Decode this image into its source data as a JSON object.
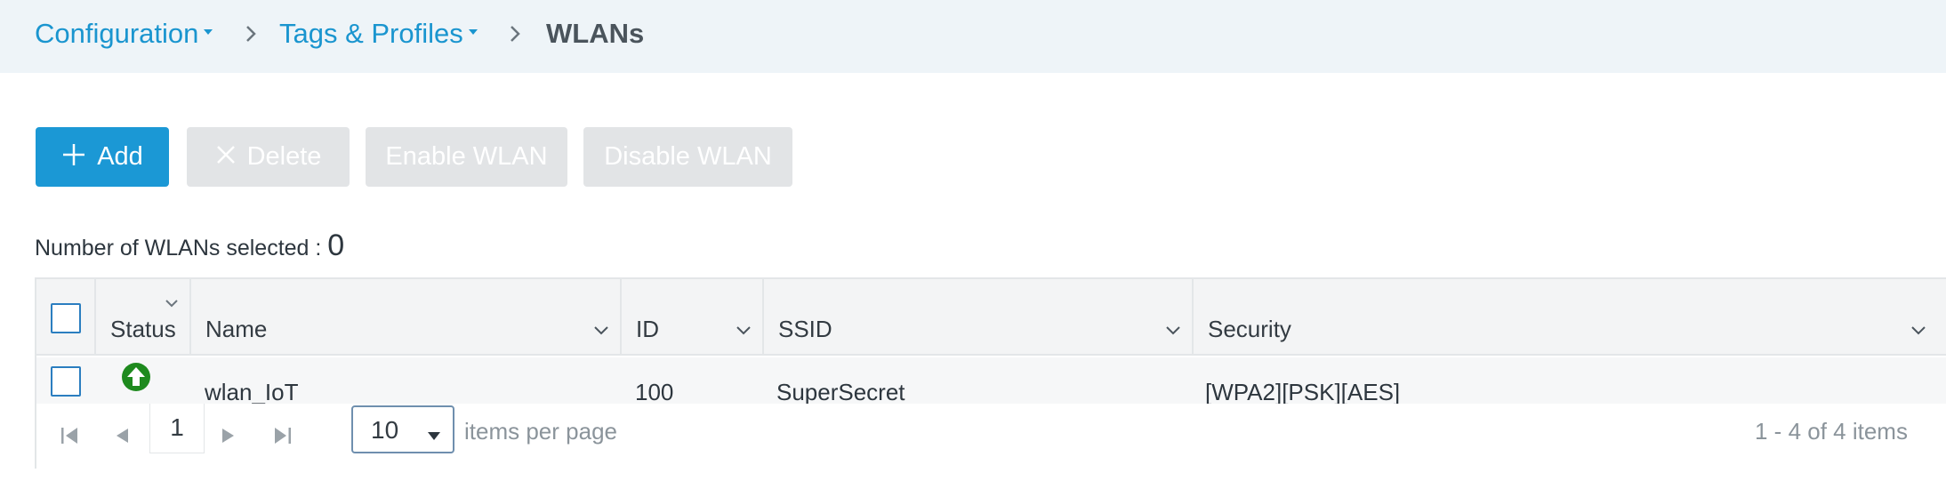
{
  "breadcrumb": {
    "items": [
      {
        "label": "Configuration",
        "has_dropdown": true
      },
      {
        "label": "Tags & Profiles",
        "has_dropdown": true
      },
      {
        "label": "WLANs",
        "current": true
      }
    ]
  },
  "toolbar": {
    "add_label": "Add",
    "delete_label": "Delete",
    "enable_label": "Enable WLAN",
    "disable_label": "Disable WLAN"
  },
  "selection": {
    "prefix": "Number of WLANs selected : ",
    "count": "0"
  },
  "table": {
    "columns": [
      "Status",
      "Name",
      "ID",
      "SSID",
      "Security"
    ],
    "rows": [
      {
        "status": "up",
        "name": "wlan_IoT",
        "id": "100",
        "ssid": "SuperSecret",
        "security": "[WPA2][PSK][AES]"
      }
    ]
  },
  "pagination": {
    "current_page": "1",
    "page_size": "10",
    "items_per_page_label": "items per page",
    "summary": "1 - 4 of 4 items"
  },
  "colors": {
    "accent": "#1b98d5",
    "link": "#1a95cf",
    "status_up": "#1e8a1e",
    "disabled_button": "#e2e4e6"
  },
  "icons": [
    "caret-down-icon",
    "chevron-right-icon",
    "plus-icon",
    "close-icon",
    "sort-chevron-icon",
    "status-up-icon",
    "first-page-icon",
    "prev-page-icon",
    "next-page-icon",
    "last-page-icon"
  ]
}
